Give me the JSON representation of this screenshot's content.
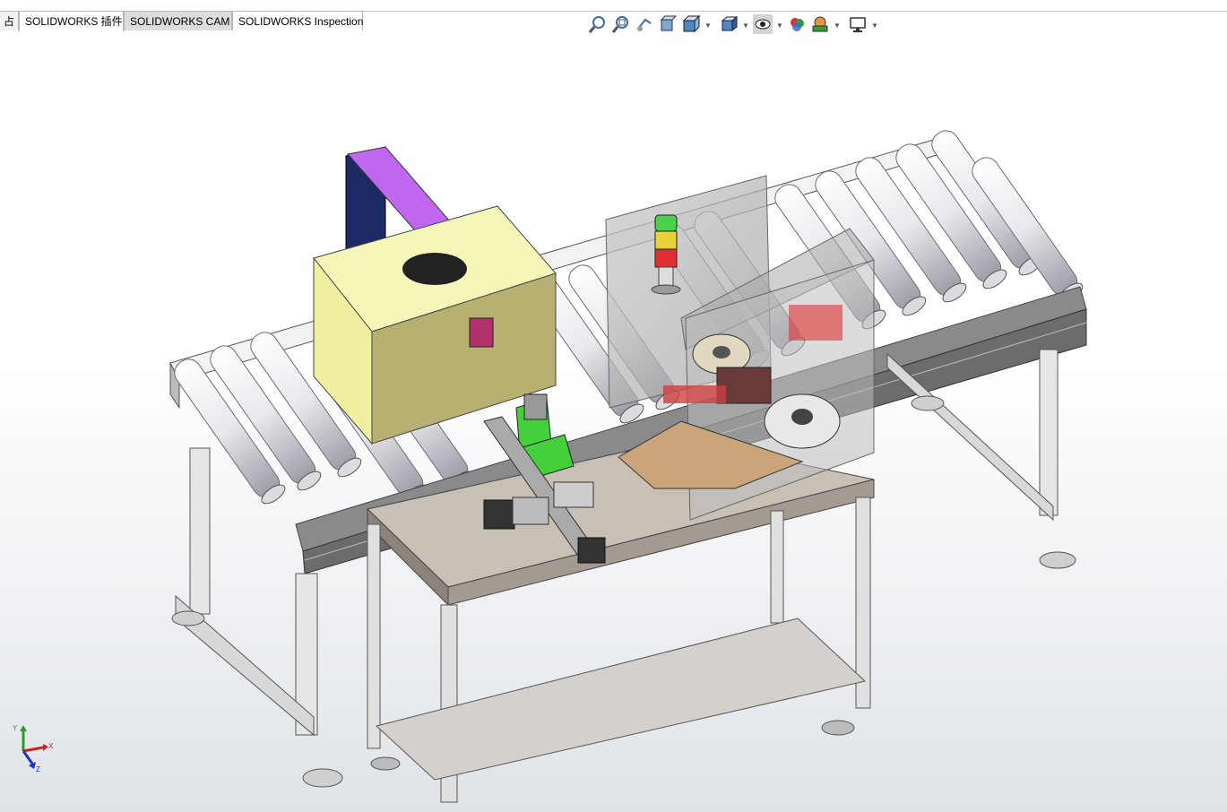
{
  "tabs": [
    {
      "label": "占",
      "state": "partial"
    },
    {
      "label": "SOLIDWORKS 插件",
      "state": "active"
    },
    {
      "label": "SOLIDWORKS CAM",
      "state": "normal"
    },
    {
      "label": "SOLIDWORKS Inspection",
      "state": "normal"
    }
  ],
  "hud_toolbar": [
    {
      "icon": "zoom-to-fit-icon"
    },
    {
      "icon": "zoom-to-area-icon"
    },
    {
      "icon": "previous-view-icon"
    },
    {
      "icon": "section-view-icon"
    },
    {
      "icon": "view-orientation-icon",
      "dropdown": true
    },
    {
      "icon": "display-style-icon",
      "dropdown": true
    },
    {
      "icon": "hide-show-items-icon",
      "dropdown": true
    },
    {
      "icon": "edit-appearance-icon"
    },
    {
      "icon": "apply-scene-icon",
      "dropdown": true
    },
    {
      "icon": "view-settings-icon",
      "dropdown": true
    }
  ],
  "triad": {
    "x_label": "X",
    "y_label": "Y",
    "z_label": "Z"
  },
  "colors": {
    "purple_arm": "#c067f0",
    "navy_post": "#1e2a66",
    "yellow_box": "#eef0a0",
    "green_part": "#44d03a",
    "guard_glass": "#b9b9b9",
    "roller": "#e9e9ee",
    "table_top": "#c8bfb5",
    "red_light": "#e03030"
  }
}
